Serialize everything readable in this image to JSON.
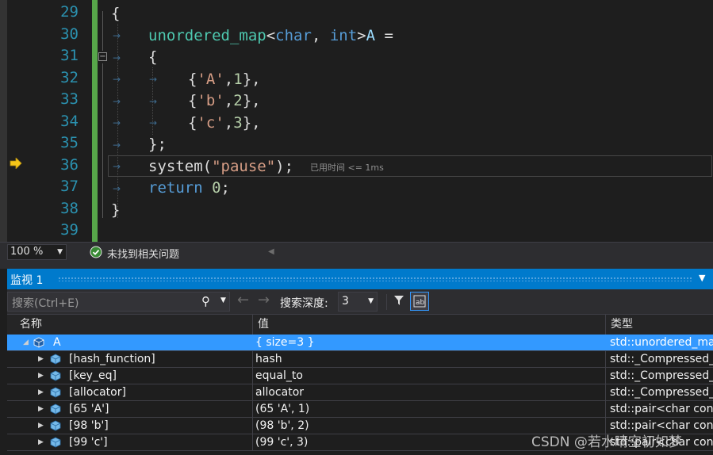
{
  "editor": {
    "line_numbers": [
      "29",
      "30",
      "31",
      "32",
      "33",
      "34",
      "35",
      "36",
      "37",
      "38",
      "39"
    ],
    "perf_tip": "已用时间 <= 1ms",
    "code": {
      "l29": "{",
      "l30_type": "unordered_map",
      "l30_lt": "<",
      "l30_char": "char",
      "l30_comma": ", ",
      "l30_int": "int",
      "l30_gt": ">",
      "l30_var": "A",
      "l30_eq": " =",
      "l31": "{",
      "l32_open": "{",
      "l32_str": "'A'",
      "l32_comma": ",",
      "l32_num": "1",
      "l32_close": "},",
      "l33_open": "{",
      "l33_str": "'b'",
      "l33_comma": ",",
      "l33_num": "2",
      "l33_close": "},",
      "l34_open": "{",
      "l34_str": "'c'",
      "l34_comma": ",",
      "l34_num": "3",
      "l34_close": "},",
      "l35": "};",
      "l36_fn": "system",
      "l36_paren": "(",
      "l36_str": "\"pause\"",
      "l36_end": ");",
      "l37_kw": "return",
      "l37_num": "0",
      "l37_end": ";",
      "l38": "}"
    }
  },
  "status": {
    "zoom": "100 %",
    "issues": "未找到相关问题"
  },
  "watch": {
    "title": "监视 1",
    "search_placeholder": "搜索(Ctrl+E)",
    "depth_label": "搜索深度:",
    "depth_value": "3",
    "columns": {
      "name": "名称",
      "value": "值",
      "type": "类型"
    },
    "rows": [
      {
        "name": "A",
        "value": "{ size=3 }",
        "type": "std::unordered_map"
      },
      {
        "name": "[hash_function]",
        "value": "hash",
        "type": "std::_Compressed_p"
      },
      {
        "name": "[key_eq]",
        "value": "equal_to",
        "type": "std::_Compressed_p"
      },
      {
        "name": "[allocator]",
        "value": "allocator",
        "type": "std::_Compressed_p"
      },
      {
        "name": "[65 'A']",
        "value": "(65 'A', 1)",
        "type": "std::pair<char const"
      },
      {
        "name": "[98 'b']",
        "value": "(98 'b', 2)",
        "type": "std::pair<char const"
      },
      {
        "name": "[99 'c']",
        "value": "(99 'c', 3)",
        "type": "std::pair<char const"
      }
    ]
  },
  "watermark": "CSDN @若水晴空初如梦",
  "colors": {
    "accent": "#007acc",
    "selection": "#3399ff",
    "change_bar": "#57a64a"
  }
}
